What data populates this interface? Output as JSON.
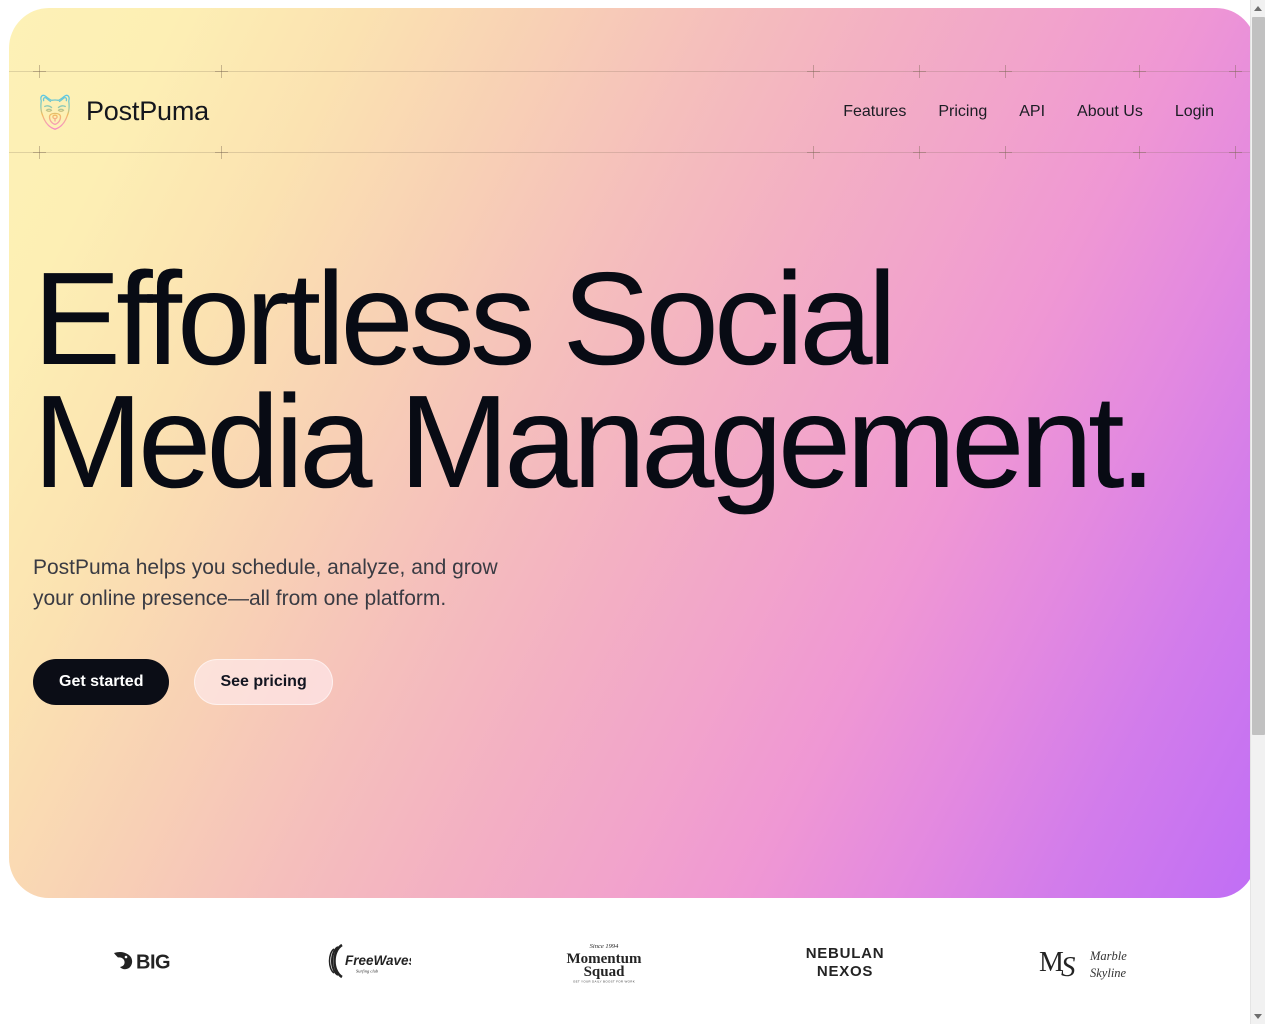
{
  "brand": {
    "name": "PostPuma",
    "logo_icon": "puma-head-icon",
    "logo_gradient": [
      "#5ec8e8",
      "#f2b95c",
      "#f48fc4"
    ]
  },
  "nav": {
    "items": [
      {
        "label": "Features"
      },
      {
        "label": "Pricing"
      },
      {
        "label": "API"
      },
      {
        "label": "About Us"
      },
      {
        "label": "Login"
      }
    ]
  },
  "hero": {
    "title": "Effortless Social\nMedia Management.",
    "subtitle": "PostPuma helps you schedule, analyze, and grow your online presence—all from one platform.",
    "primary_cta": "Get started",
    "secondary_cta": "See pricing",
    "gradient": {
      "start": "#fdf1b6",
      "mid": "#f3b0c3",
      "end": "#c06ef5"
    },
    "title_color": "#080b14",
    "primary_cta_bg": "#0b0d16"
  },
  "logos": [
    {
      "name": "BIG",
      "id": "logo-big"
    },
    {
      "name": "FreeWaves",
      "tagline": "Surfing club",
      "id": "logo-freewaves"
    },
    {
      "name": "Momentum Squad",
      "script_top": "Since 1994",
      "tagline": "Get Your Daily Boost For Work",
      "id": "logo-momentum-squad"
    },
    {
      "name": "NEBULAN NEXOS",
      "line1": "NEBULAN",
      "line2": "NEXOS",
      "id": "logo-nebulan-nexos"
    },
    {
      "name": "Marble Skyline",
      "monogram": "MS",
      "script1": "Marble",
      "script2": "Skyline",
      "id": "logo-marble-skyline"
    }
  ],
  "scrollbar": {
    "up_icon": "scroll-up-arrow-icon",
    "down_icon": "scroll-down-arrow-icon"
  }
}
